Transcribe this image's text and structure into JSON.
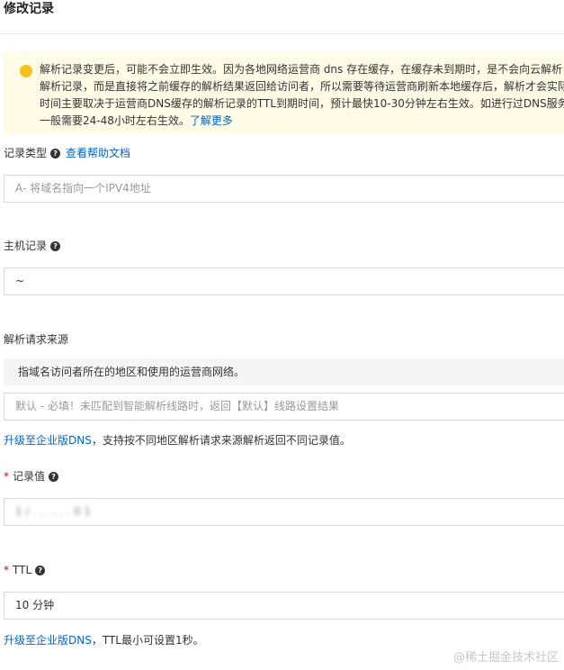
{
  "page": {
    "title": "修改记录"
  },
  "notice": {
    "lines": [
      "解析记录变更后，可能不会立即生效。因为各地网络运营商 dns 存在缓存，在缓存未到期时，是不会向云解析 I",
      "解析记录，而是直接将之前缓存的解析结果返回给访问者，所以需要等待运营商刷新本地缓存后，解析才会实际",
      "时间主要取决于运营商DNS缓存的解析记录的TTL到期时间，预计最快10-30分钟左右生效。如进行过DNS服务",
      "一般需要24-48小时左右生效。"
    ],
    "link_label": "了解更多"
  },
  "record_type": {
    "label": "记录类型",
    "help_link": "查看帮助文档",
    "placeholder": "A- 将域名指向一个IPV4地址"
  },
  "host_record": {
    "label": "主机记录",
    "value": "~"
  },
  "request_source": {
    "label": "解析请求来源",
    "description": "指域名访问者所在的地区和使用的运营商网络。",
    "placeholder": "默认 - 必填！未匹配到智能解析线路时，返回【默认】线路设置结果",
    "upgrade_link": "升级至企业版DNS",
    "upgrade_text": "，支持按不同地区解析请求来源解析返回不同记录值。"
  },
  "record_value": {
    "required_mark": "*",
    "label": "记录值",
    "value": "1 / . . . . . . 0 1"
  },
  "ttl": {
    "required_mark": "*",
    "label": "TTL",
    "value": "10 分钟",
    "upgrade_link": "升级至企业版DNS",
    "upgrade_text": "，TTL最小可设置1秒。"
  },
  "watermark": {
    "text": "@稀土掘金技术社区"
  },
  "colors": {
    "link": "#0066cc",
    "required": "#d9001b",
    "notice_bg": "#fffbe6",
    "notice_icon": "#f5c21b"
  }
}
